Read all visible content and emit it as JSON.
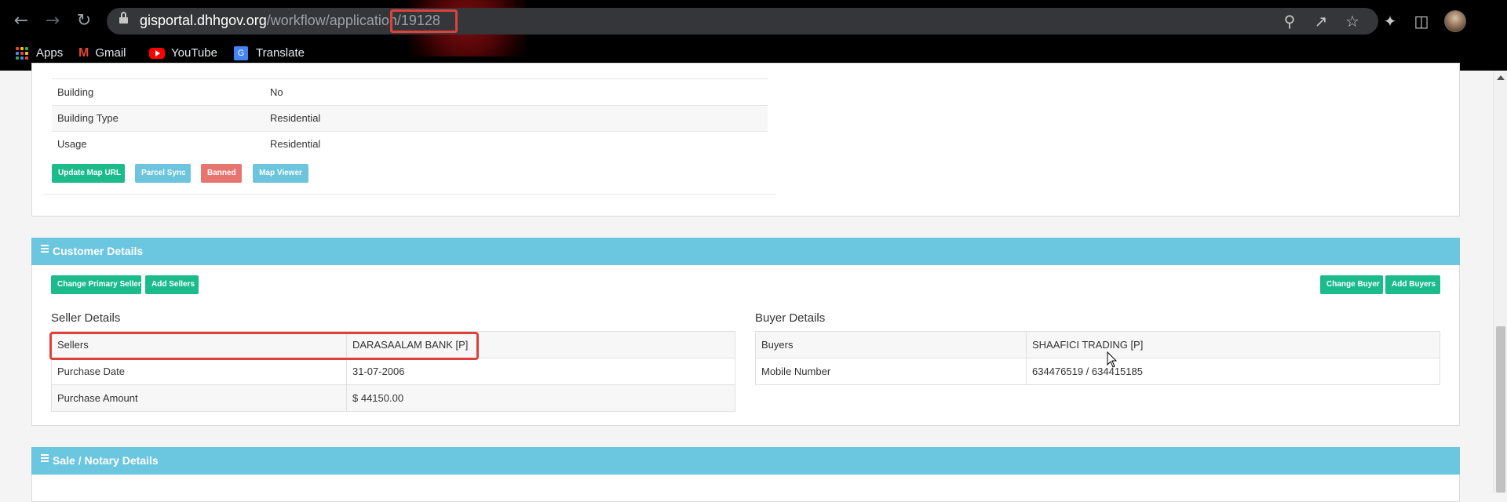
{
  "browser": {
    "url_host": "gisportal.dhhgov.org",
    "url_path": "/workflow/application/19128",
    "bookmarks": [
      {
        "label": "Apps",
        "icon": "apps-grid-icon"
      },
      {
        "label": "Gmail",
        "icon": "gmail-icon"
      },
      {
        "label": "YouTube",
        "icon": "youtube-icon"
      },
      {
        "label": "Translate",
        "icon": "translate-icon"
      }
    ]
  },
  "property": {
    "rows": [
      {
        "label": "Building",
        "value": "No"
      },
      {
        "label": "Building Type",
        "value": "Residential"
      },
      {
        "label": "Usage",
        "value": "Residential"
      }
    ],
    "buttons": {
      "update_map": "Update Map URL",
      "parcel_sync": "Parcel Sync",
      "banned": "Banned",
      "map_viewer": "Map Viewer"
    }
  },
  "customer": {
    "title": "Customer Details",
    "buttons": {
      "change_primary_seller": "Change Primary Seller",
      "add_sellers": "Add Sellers",
      "change_buyer": "Change Buyer",
      "add_buyers": "Add Buyers"
    },
    "seller": {
      "title": "Seller Details",
      "rows": [
        {
          "label": "Sellers",
          "value": "DARASAALAM BANK [P]"
        },
        {
          "label": "Purchase Date",
          "value": "31-07-2006"
        },
        {
          "label": "Purchase Amount",
          "value": "$ 44150.00"
        }
      ]
    },
    "buyer": {
      "title": "Buyer Details",
      "rows": [
        {
          "label": "Buyers",
          "value": "SHAAFICI TRADING [P]"
        },
        {
          "label": "Mobile Number",
          "value": "634476519 / 634415185"
        }
      ]
    }
  },
  "sale": {
    "title": "Sale / Notary Details"
  },
  "colors": {
    "section_header": "#6bc6e0",
    "green_button": "#1cbb8c",
    "blue_button": "#6cc5dc",
    "red_button": "#e87470",
    "highlight": "#e0403a"
  }
}
